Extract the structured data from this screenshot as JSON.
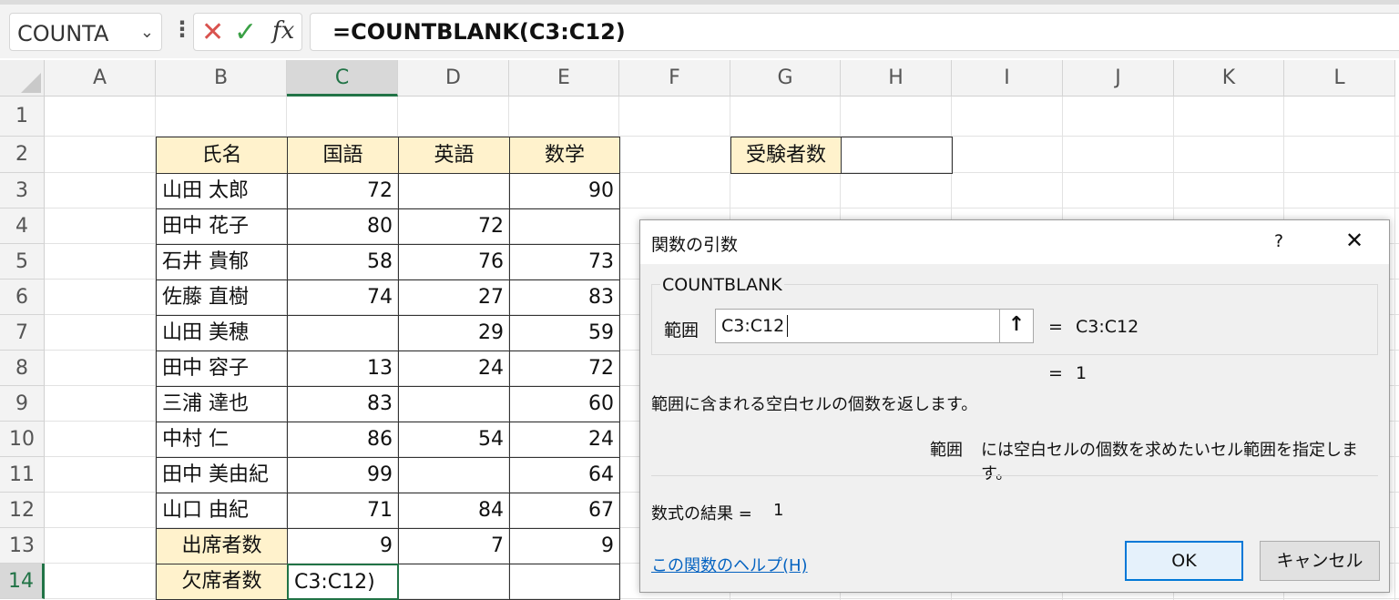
{
  "formula_bar": {
    "name_box": "COUNTA",
    "formula": "=COUNTBLANK(C3:C12)"
  },
  "columns": [
    "A",
    "B",
    "C",
    "D",
    "E",
    "F",
    "G",
    "H",
    "I",
    "J",
    "K",
    "L"
  ],
  "rows": [
    "1",
    "2",
    "3",
    "4",
    "5",
    "6",
    "7",
    "8",
    "9",
    "10",
    "11",
    "12",
    "13",
    "14"
  ],
  "table": {
    "headers": [
      "氏名",
      "国語",
      "英語",
      "数学"
    ],
    "names": [
      "山田 太郎",
      "田中 花子",
      "石井 貴郁",
      "佐藤 直樹",
      "山田 美穂",
      "田中 容子",
      "三浦 達也",
      "中村 仁",
      "田中 美由紀",
      "山口 由紀"
    ],
    "kokugo": [
      "72",
      "80",
      "58",
      "74",
      "",
      "13",
      "83",
      "86",
      "99",
      "71"
    ],
    "eigo": [
      "",
      "72",
      "76",
      "27",
      "29",
      "24",
      "",
      "54",
      "",
      "84"
    ],
    "sugaku": [
      "90",
      "",
      "73",
      "83",
      "59",
      "72",
      "60",
      "24",
      "64",
      "67"
    ],
    "attend_label": "出席者数",
    "attend": [
      "9",
      "7",
      "9"
    ],
    "absent_label": "欠席者数",
    "absent_editing": "C3:C12)"
  },
  "side": {
    "label": "受験者数",
    "value": ""
  },
  "dialog": {
    "title": "関数の引数",
    "help": "?",
    "close": "✕",
    "function_name": "COUNTBLANK",
    "arg_label": "範囲",
    "arg_value": "C3:C12",
    "arg_eq": "=",
    "arg_result": "C3:C12",
    "result_eq": "=",
    "result_value": "1",
    "description": "範囲に含まれる空白セルの個数を返します。",
    "arg_desc_name": "範囲",
    "arg_desc": "には空白セルの個数を求めたいセル範囲を指定します。",
    "formula_result_label": "数式の結果 =",
    "formula_result_value": "1",
    "help_link": "この関数のヘルプ(H)",
    "ok": "OK",
    "cancel": "キャンセル"
  },
  "colors": {
    "header_fill": "#fff2cc",
    "selection": "#217346",
    "ok_border": "#0078d7",
    "link": "#0563c1"
  }
}
